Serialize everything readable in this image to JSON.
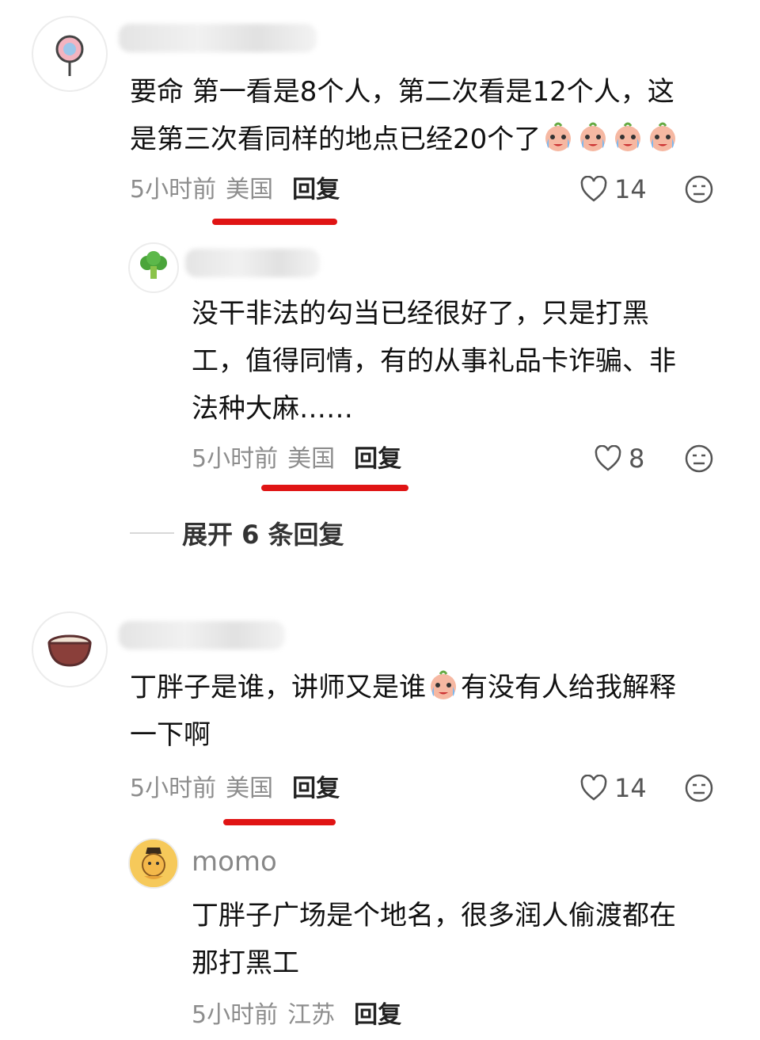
{
  "comments": [
    {
      "text_line1": "要命 第一看是8个人，第二次看是12个人，这",
      "text_line2": "是第三次看同样的地点已经20个了",
      "time": "5小时前",
      "location": "美国",
      "reply_label": "回复",
      "likes": "14",
      "reply": {
        "text_line1": "没干非法的勾当已经很好了，只是打黑",
        "text_line2": "工，值得同情，有的从事礼品卡诈骗、非",
        "text_line3": "法种大麻……",
        "time": "5小时前",
        "location": "美国",
        "reply_label": "回复",
        "likes": "8"
      },
      "expand_label": "展开 6 条回复"
    },
    {
      "text_line1_a": "丁胖子是谁，讲师又是谁",
      "text_line1_b": "有没有人给我解释",
      "text_line2": "一下啊",
      "time": "5小时前",
      "location": "美国",
      "reply_label": "回复",
      "likes": "14",
      "reply": {
        "username": "momo",
        "text_line1": "丁胖子广场是个地名，很多润人偷渡都在",
        "text_line2": "那打黑工",
        "time": "5小时前",
        "location": "江苏",
        "reply_label": "回复"
      }
    }
  ],
  "watermark": "",
  "colors": {
    "annotation_red": "#e01414",
    "meta_gray": "#8d8d8d"
  }
}
